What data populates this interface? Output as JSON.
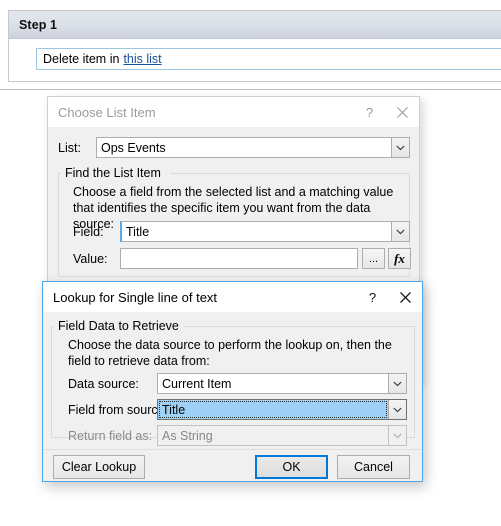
{
  "step_panel": {
    "title": "Step 1",
    "sentence_prefix": "Delete item in",
    "sentence_link": "this list"
  },
  "choose_list_item_dialog": {
    "title": "Choose List Item",
    "help_button": "?",
    "close_button": "✕",
    "list_label": "List:",
    "list_value": "Ops Events",
    "group_legend": "Find the List Item",
    "help_text": "Choose a field from the selected list and a matching value that identifies the specific item you want from the data source:",
    "field_label": "Field:",
    "field_value": "Title",
    "value_label": "Value:",
    "value_value": "",
    "ellipsis_button": "...",
    "fx_button": "fx"
  },
  "lookup_dialog": {
    "title": "Lookup for Single line of text",
    "help_button": "?",
    "close_button": "✕",
    "group_legend": "Field Data to Retrieve",
    "help_text": "Choose the data source to perform the lookup on, then the field to retrieve data from:",
    "data_source_label": "Data source:",
    "data_source_value": "Current Item",
    "field_from_source_label": "Field from source:",
    "field_from_source_value": "Title",
    "return_field_as_label": "Return field as:",
    "return_field_as_value": "As String",
    "clear_lookup_button": "Clear Lookup",
    "ok_button": "OK",
    "cancel_button": "Cancel"
  },
  "colors": {
    "accent_blue": "#0078d7",
    "active_window_border": "#4ca6e8",
    "selection_blue": "#9ed1f5",
    "link_blue": "#1a4f9c",
    "dialog_face": "#f0f0f0"
  }
}
